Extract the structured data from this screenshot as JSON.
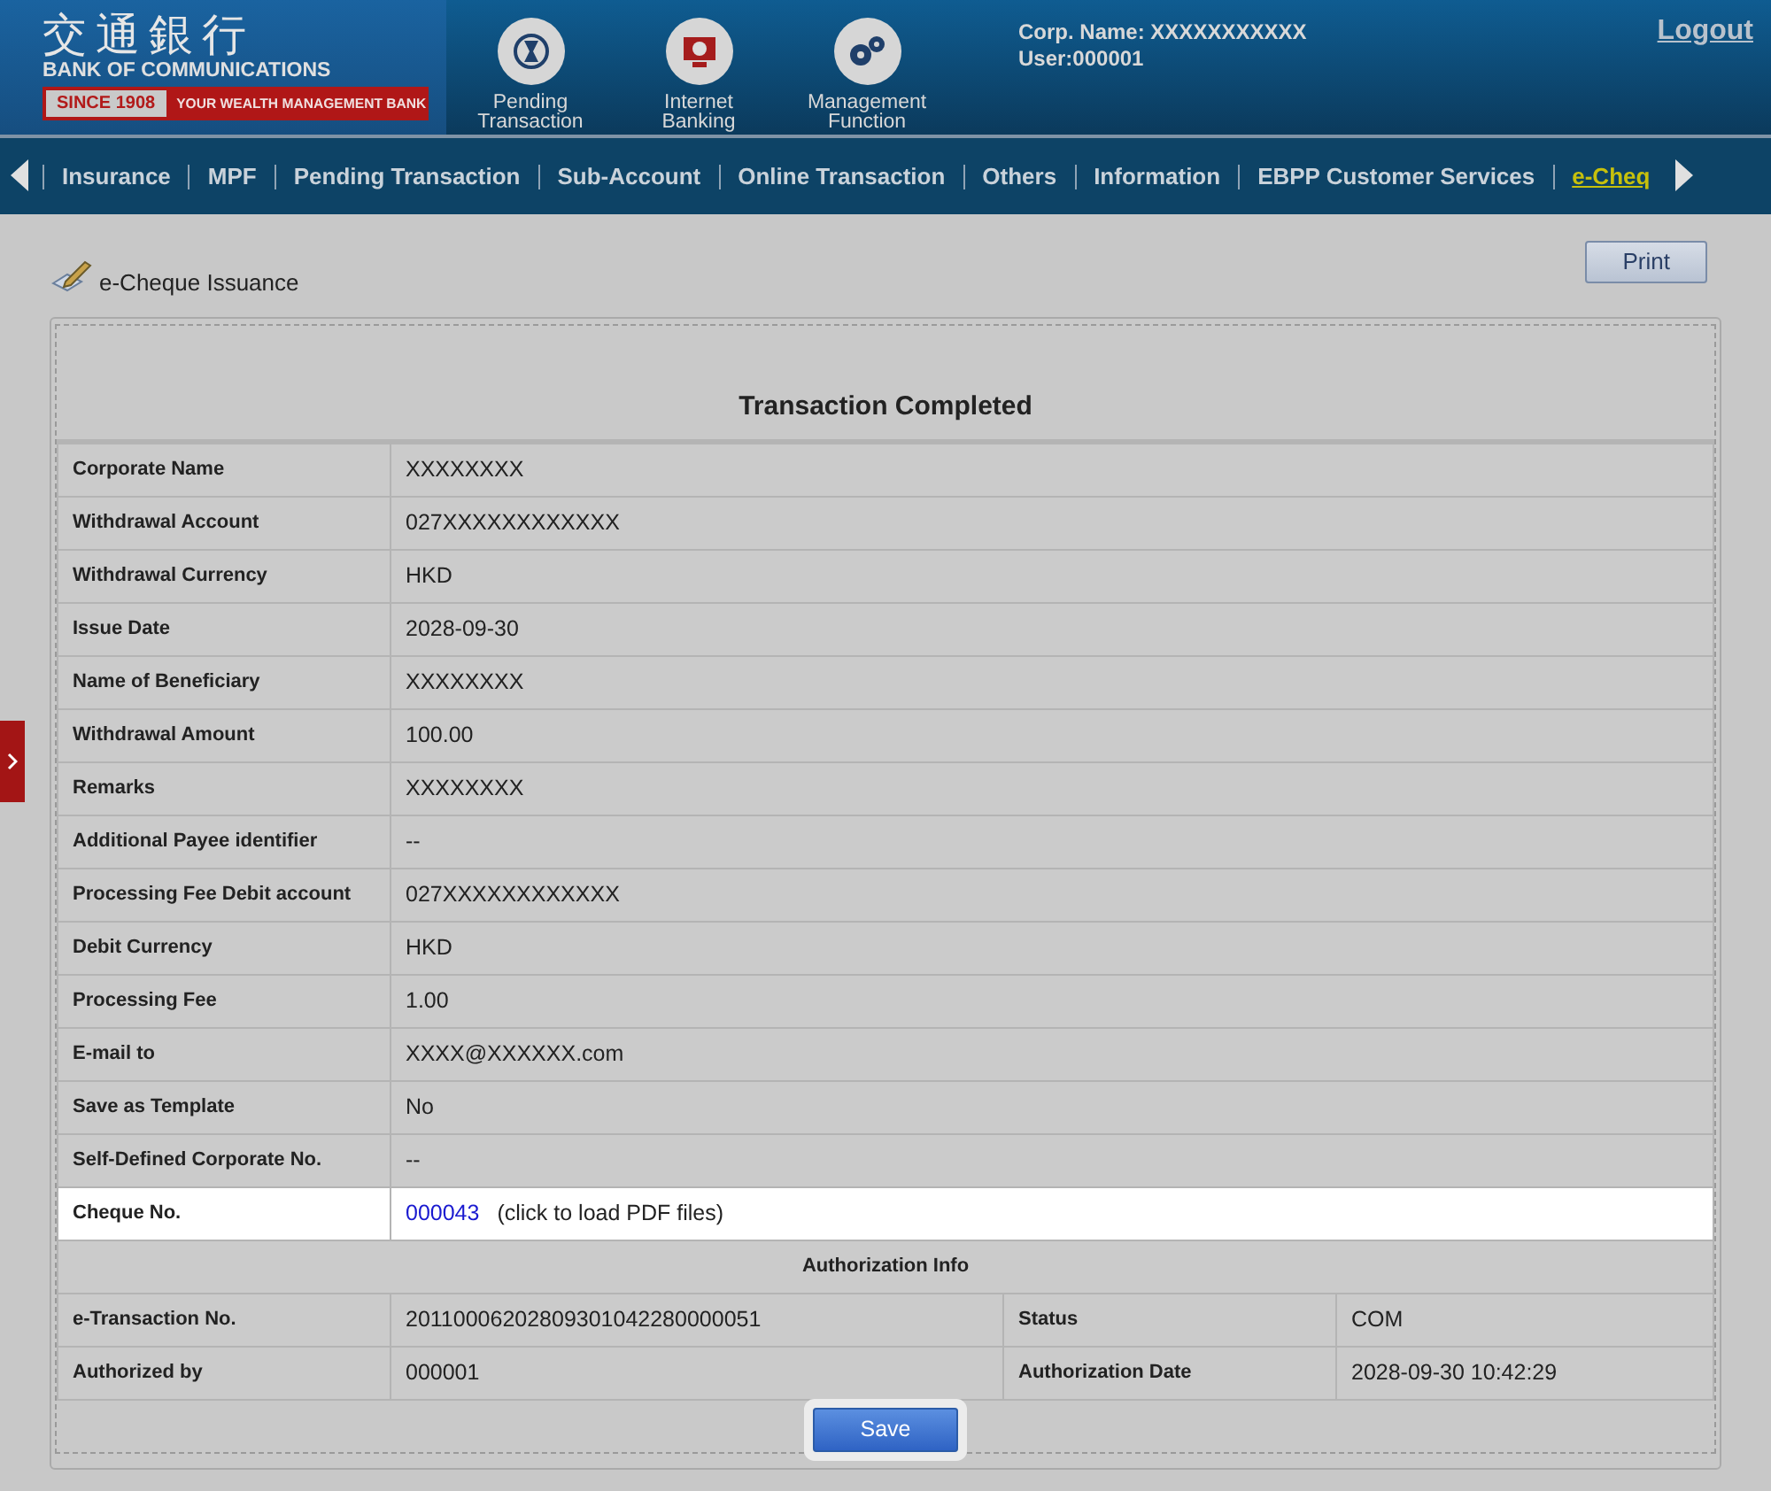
{
  "logo": {
    "chinese": "交通銀行",
    "english": "BANK OF COMMUNICATIONS",
    "since": "SINCE 1908",
    "slogan": "YOUR WEALTH MANAGEMENT BANK"
  },
  "shortcuts": [
    {
      "kind": "pending",
      "lines": [
        "Pending",
        "Transaction"
      ]
    },
    {
      "kind": "banking",
      "lines": [
        "Internet",
        "Banking"
      ]
    },
    {
      "kind": "management",
      "lines": [
        "Management",
        "Function"
      ]
    }
  ],
  "user": {
    "corp_name": "Corp. Name: XXXXXXXXXXX",
    "user": "User:000001"
  },
  "logout": "Logout",
  "nav": [
    {
      "label": "Insurance",
      "selected": false
    },
    {
      "label": "MPF",
      "selected": false
    },
    {
      "label": "Pending Transaction",
      "selected": false
    },
    {
      "label": "Sub-Account",
      "selected": false
    },
    {
      "label": "Online Transaction",
      "selected": false
    },
    {
      "label": "Others",
      "selected": false
    },
    {
      "label": "Information",
      "selected": false
    },
    {
      "label": "EBPP Customer Services",
      "selected": false
    },
    {
      "label": "e-Cheq",
      "selected": true
    }
  ],
  "page_title": "e-Cheque Issuance",
  "print_button": "Print",
  "result_title": "Transaction Completed",
  "details": [
    {
      "label": "Corporate Name",
      "value": "XXXXXXXX",
      "highlighted": false
    },
    {
      "label": "Withdrawal Account",
      "value": "027XXXXXXXXXXXX",
      "highlighted": false
    },
    {
      "label": "Withdrawal Currency",
      "value": "HKD",
      "highlighted": false
    },
    {
      "label": "Issue Date",
      "value": "2028-09-30",
      "highlighted": false
    },
    {
      "label": "Name of Beneficiary",
      "value": "XXXXXXXX",
      "highlighted": false
    },
    {
      "label": "Withdrawal Amount",
      "value": "100.00",
      "highlighted": false
    },
    {
      "label": "Remarks",
      "value": "XXXXXXXX",
      "highlighted": false
    },
    {
      "label": "Additional Payee identifier",
      "value": "--",
      "highlighted": false
    },
    {
      "label": "Processing Fee Debit account",
      "value": "027XXXXXXXXXXXX",
      "highlighted": false
    },
    {
      "label": "Debit Currency",
      "value": "HKD",
      "highlighted": false
    },
    {
      "label": "Processing Fee",
      "value": "1.00",
      "highlighted": false
    },
    {
      "label": "E-mail to",
      "value": "XXXX@XXXXXX.com",
      "highlighted": false
    },
    {
      "label": "Save as Template",
      "value": "No",
      "highlighted": false
    },
    {
      "label": "Self-Defined Corporate No.",
      "value": "--",
      "highlighted": false
    },
    {
      "label": "Cheque No.",
      "link": "000043",
      "note": "(click to load PDF files)",
      "highlighted": true
    }
  ],
  "authorization": {
    "title": "Authorization Info",
    "rows": [
      [
        {
          "label": "e-Transaction No.",
          "value": "20110006202809301042280000051"
        },
        {
          "label": "Status",
          "value": "COM"
        }
      ],
      [
        {
          "label": "Authorized by",
          "value": "000001"
        },
        {
          "label": "Authorization Date",
          "value": "2028-09-30 10:42:29"
        }
      ]
    ]
  },
  "save_button": {
    "label": "Save",
    "highlighted": true
  }
}
